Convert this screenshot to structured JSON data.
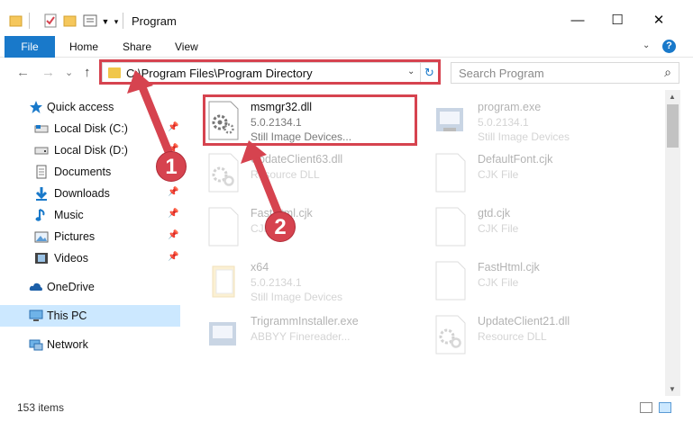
{
  "window": {
    "title": "Program",
    "minimize": "—",
    "maximize": "☐",
    "close": "✕"
  },
  "ribbon": {
    "tabs": [
      "File",
      "Home",
      "Share",
      "View"
    ],
    "expand": "⌄",
    "help": "?"
  },
  "navigation": {
    "back": "←",
    "forward": "→",
    "recent": "⌄",
    "up": "↑",
    "address": "C:\\Program Files\\Program Directory",
    "address_dropdown": "⌄",
    "refresh": "↻",
    "search_placeholder": "Search Program",
    "search_icon": "⌕"
  },
  "sidebar": {
    "items": [
      {
        "label": "Quick access",
        "icon": "star-icon"
      },
      {
        "label": "Local Disk (C:)",
        "icon": "drive-icon"
      },
      {
        "label": "Local Disk (D:)",
        "icon": "drive-icon"
      },
      {
        "label": "Documents",
        "icon": "documents-icon"
      },
      {
        "label": "Downloads",
        "icon": "download-icon"
      },
      {
        "label": "Music",
        "icon": "music-icon"
      },
      {
        "label": "Pictures",
        "icon": "pictures-icon"
      },
      {
        "label": "Videos",
        "icon": "video-icon"
      },
      {
        "label": "OneDrive",
        "icon": "cloud-icon"
      },
      {
        "label": "This PC",
        "icon": "computer-icon"
      },
      {
        "label": "Network",
        "icon": "network-icon"
      }
    ]
  },
  "files": [
    {
      "name": "msmgr32.dll",
      "line1": "5.0.2134.1",
      "line2": "Still Image Devices...",
      "icon": "dll-gear-icon"
    },
    {
      "name": "program.exe",
      "line1": "5.0.2134.1",
      "line2": "Still Image Devices",
      "icon": "exe-icon"
    },
    {
      "name": "UpdateClient63.dll",
      "line1": "Resource DLL",
      "line2": "",
      "icon": "dll-gear-icon"
    },
    {
      "name": "DefaultFont.cjk",
      "line1": "CJK File",
      "line2": "",
      "icon": "blank-file-icon"
    },
    {
      "name": "FastHtml.cjk",
      "line1": "CJK File",
      "line2": "",
      "icon": "blank-file-icon"
    },
    {
      "name": "gtd.cjk",
      "line1": "CJK File",
      "line2": "",
      "icon": "blank-file-icon"
    },
    {
      "name": "x64",
      "line1": "5.0.2134.1",
      "line2": "Still Image Devices",
      "icon": "folder-file-icon"
    },
    {
      "name": "FastHtml.cjk",
      "line1": "CJK File",
      "line2": "",
      "icon": "blank-file-icon"
    },
    {
      "name": "TrigrammInstaller.exe",
      "line1": "ABBYY Finereader...",
      "line2": "",
      "icon": "exe-icon"
    },
    {
      "name": "UpdateClient21.dll",
      "line1": "Resource DLL",
      "line2": "",
      "icon": "dll-gear-icon"
    }
  ],
  "status": {
    "item_count": "153 items"
  },
  "annotations": {
    "badge1": "1",
    "badge2": "2",
    "highlight_color": "#d6434f"
  },
  "colors": {
    "accent": "#1979ca",
    "selection": "#cce8ff"
  }
}
